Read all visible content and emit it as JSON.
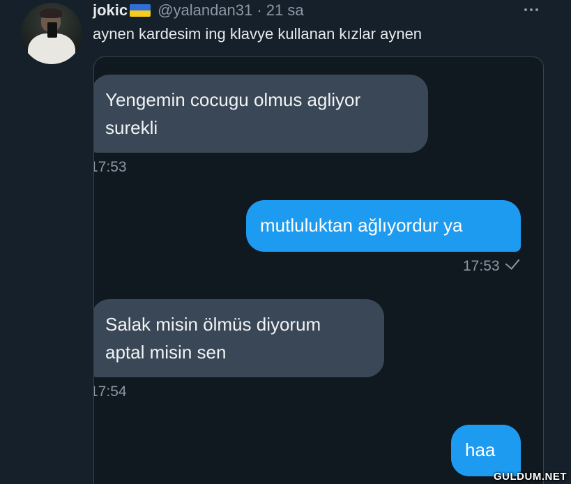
{
  "tweet": {
    "display_name": "jokic",
    "handle_line": "@yalandan31 · 21 sa",
    "text": "aynen kardesim ing klavye kullanan kızlar aynen",
    "flag_icon": "ukraine-flag-icon",
    "more_icon": "more-dots-icon"
  },
  "chat": {
    "messages": [
      {
        "side": "in",
        "lines": [
          "Yengemin cocugu olmus agliyor",
          "surekli"
        ],
        "time": "17:53"
      },
      {
        "side": "out",
        "lines": [
          "mutluluktan ağlıyordur ya"
        ],
        "time": "17:53",
        "read_icon": "check-icon"
      },
      {
        "side": "in",
        "lines": [
          "Salak misin ölmüs diyorum",
          "aptal misin sen"
        ],
        "time": "17:54"
      },
      {
        "side": "out",
        "lines": [
          "haa"
        ]
      }
    ]
  },
  "watermark": "GULDUM.NET",
  "colors": {
    "background": "#15202b",
    "incoming_bubble": "#3a4756",
    "outgoing_bubble": "#1d9bf0",
    "secondary_text": "#8b98a5"
  }
}
